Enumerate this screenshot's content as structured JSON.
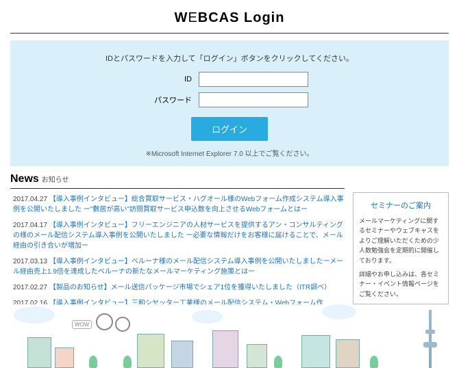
{
  "header": {
    "title_a": "W",
    "title_b": "E",
    "title_c": "BCAS",
    "title_suffix": " Login"
  },
  "login": {
    "instruction": "IDとパスワードを入力して「ログイン」ボタンをクリックしてください。",
    "id_label": "ID",
    "password_label": "パスワード",
    "button": "ログイン",
    "note": "※Microsoft Internet Explorer 7.0 以上でご覧ください。"
  },
  "news": {
    "title": "News",
    "subtitle": "お知らせ",
    "items": [
      {
        "date": "2017.04.27",
        "text": "【導入事例インタビュー】総合買取サービス・ハグオール様のWebフォーム作成システム導入事例を公開いたしました ー\"敷居が高い\"訪問買取サービス申込数を向上させるWebフォームとはー"
      },
      {
        "date": "2017.04.17",
        "text": "【導入事例インタビュー】フリーエンジニアの人材サービスを提供するアン・コンサルティングの様のメール配信システム導入事例を公開いたしました ー必要な情報だけをお客様に届けることで、メール経由の引き合いが増加ー"
      },
      {
        "date": "2017.03.13",
        "text": "【導入事例インタビュー】ベルーナ様のメール配信システム導入事例を公開いたしましたーメール経由売上1.9倍を達成したベルーナの新たなメールマーケティング施策とはー"
      },
      {
        "date": "2017.02.27",
        "text": "【製品のお知らせ】メール送信パッケージ市場でシェア1位を獲得いたしました（ITR調べ）"
      },
      {
        "date": "2017.02.16",
        "text": "【導入事例インタビュー】三和シヤッター工業様のメール配信システム・Webフォーム作"
      }
    ]
  },
  "seminar": {
    "title": "セミナーのご案内",
    "p1": "メールマーケティングに関するセミナーやウェブキャスをよりご理解いただくための少人数勉強会を定期的に開催しております。",
    "p2": "詳細やお申し込みは、各セミナー・イベント情報ページをご覧ください。"
  },
  "wow": "WOW"
}
